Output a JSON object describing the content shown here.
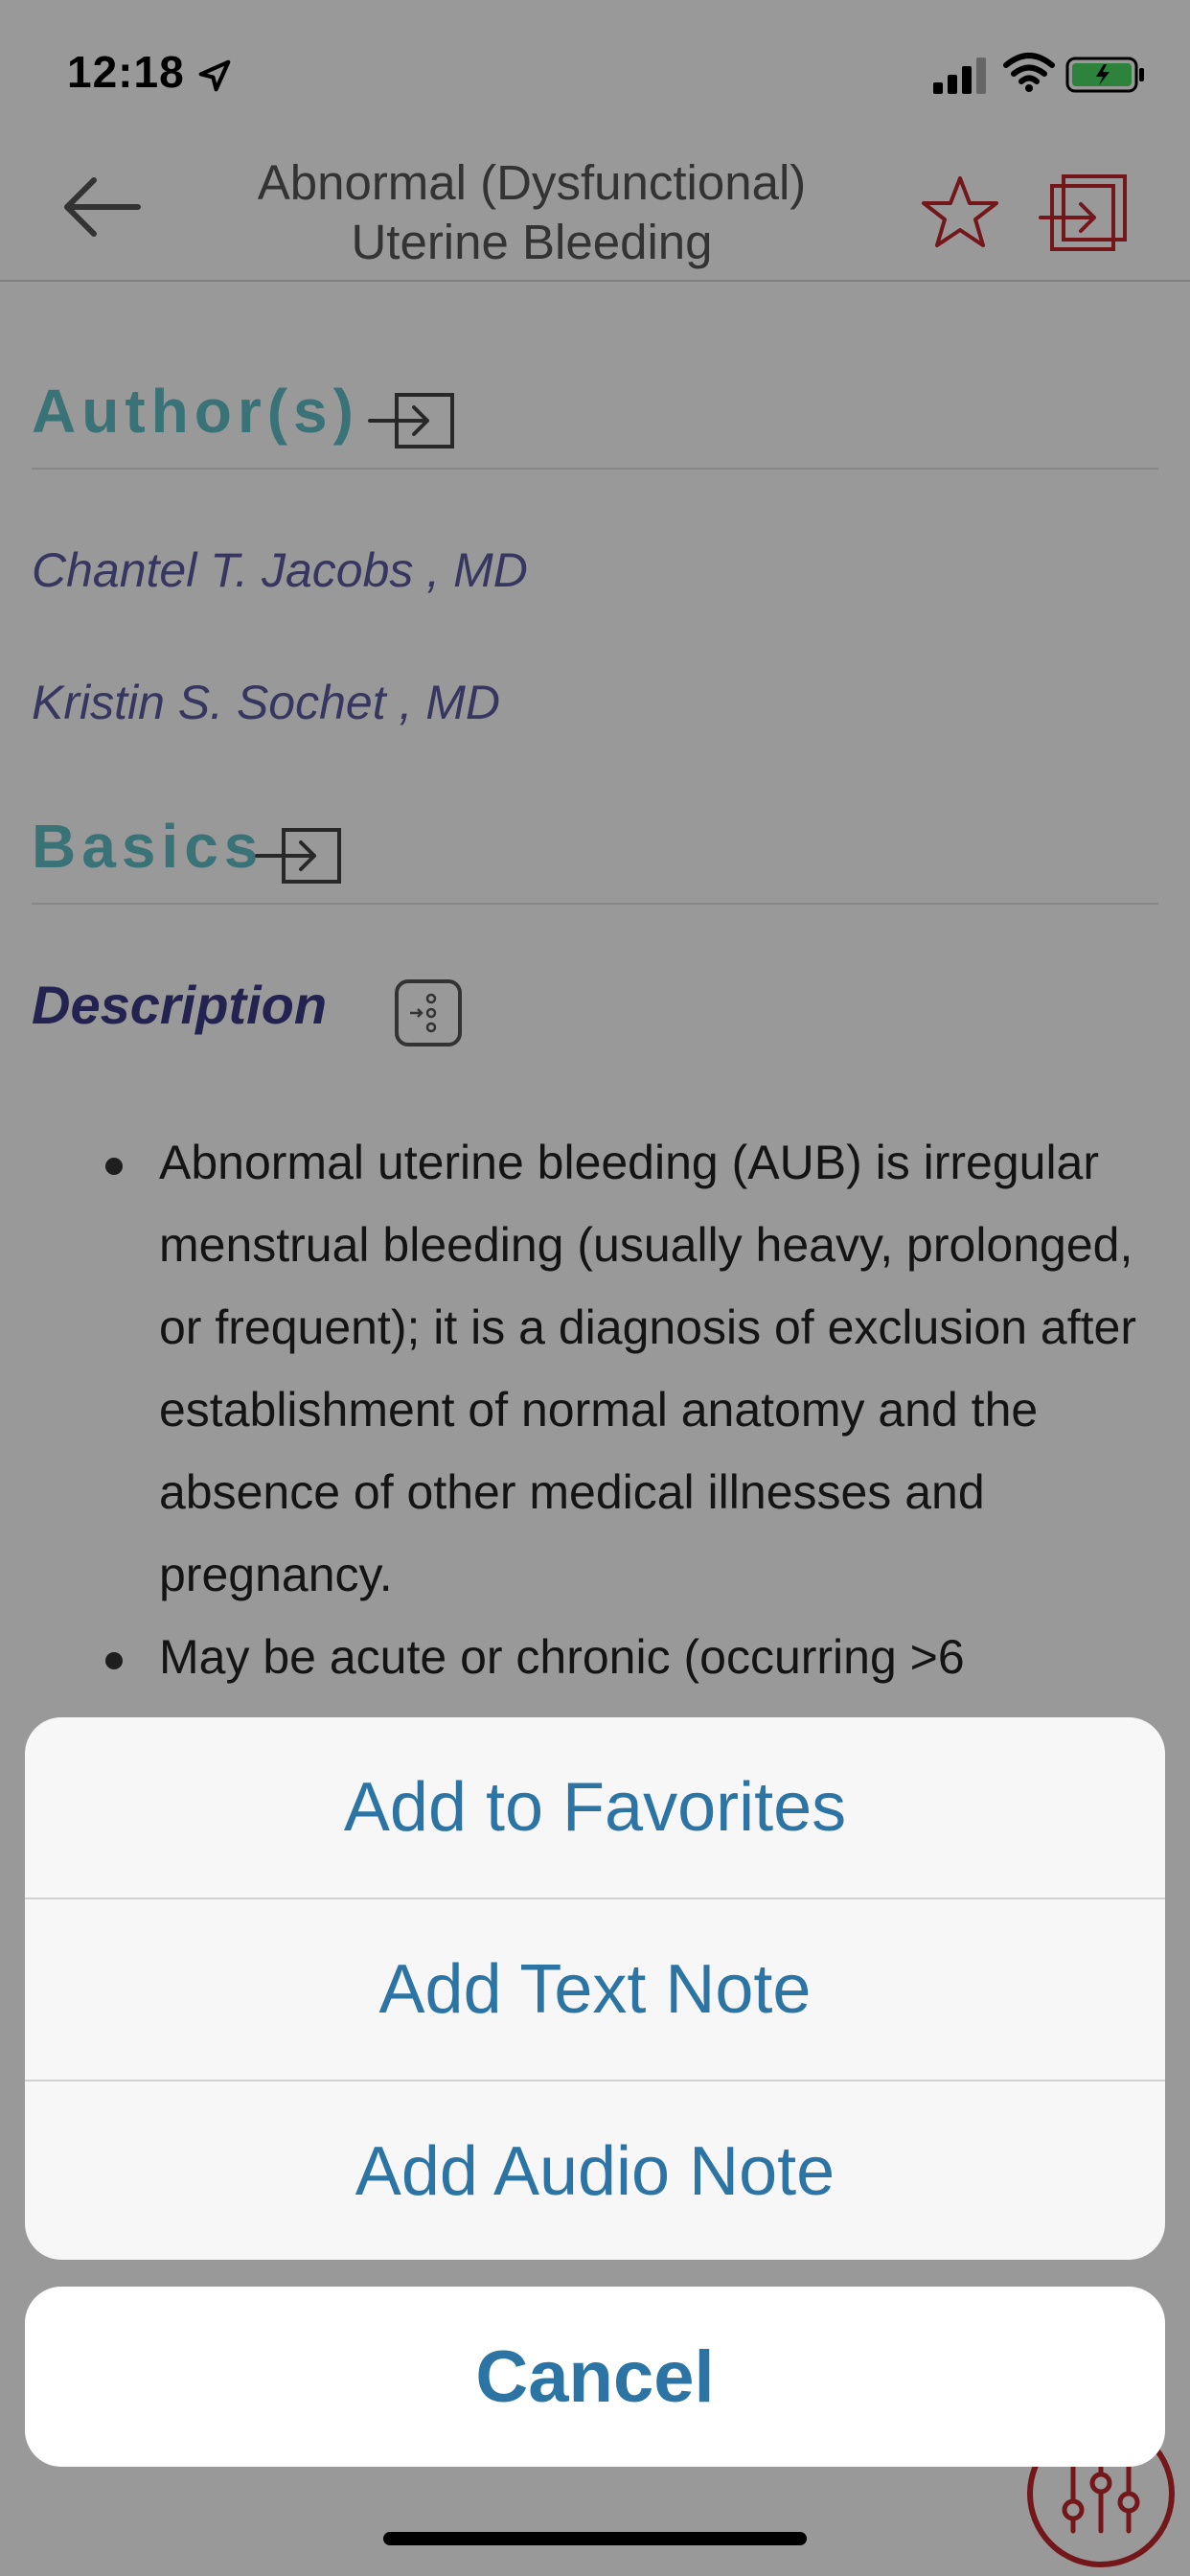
{
  "status_bar": {
    "time": "12:18"
  },
  "nav": {
    "title_line1": "Abnormal (Dysfunctional)",
    "title_line2": "Uterine Bleeding"
  },
  "content": {
    "authors_heading": "Author(s)",
    "authors": [
      "Chantel T. Jacobs , MD",
      "Kristin S. Sochet , MD"
    ],
    "basics_heading": "Basics",
    "description_heading": "Description",
    "bullets": [
      "Abnormal uterine bleeding (AUB) is irregular menstrual bleeding (usually heavy, prolonged, or frequent); it is a diagnosis of exclusion after establishment of normal anatomy and the absence of other medical illnesses and pregnancy.",
      "May be acute or chronic (occurring >6"
    ]
  },
  "action_sheet": {
    "items": [
      "Add to Favorites",
      "Add Text Note",
      "Add Audio Note"
    ],
    "cancel": "Cancel"
  },
  "colors": {
    "heading_teal": "#5fc0c9",
    "author_purple": "#5c5aa0",
    "accent_red": "#c0272d",
    "action_blue": "#2c74a4"
  },
  "icons": [
    "location-arrow-icon",
    "signal-icon",
    "wifi-icon",
    "battery-icon",
    "back-arrow-icon",
    "star-icon",
    "export-icon",
    "enter-icon",
    "expand-icon",
    "sliders-icon"
  ]
}
